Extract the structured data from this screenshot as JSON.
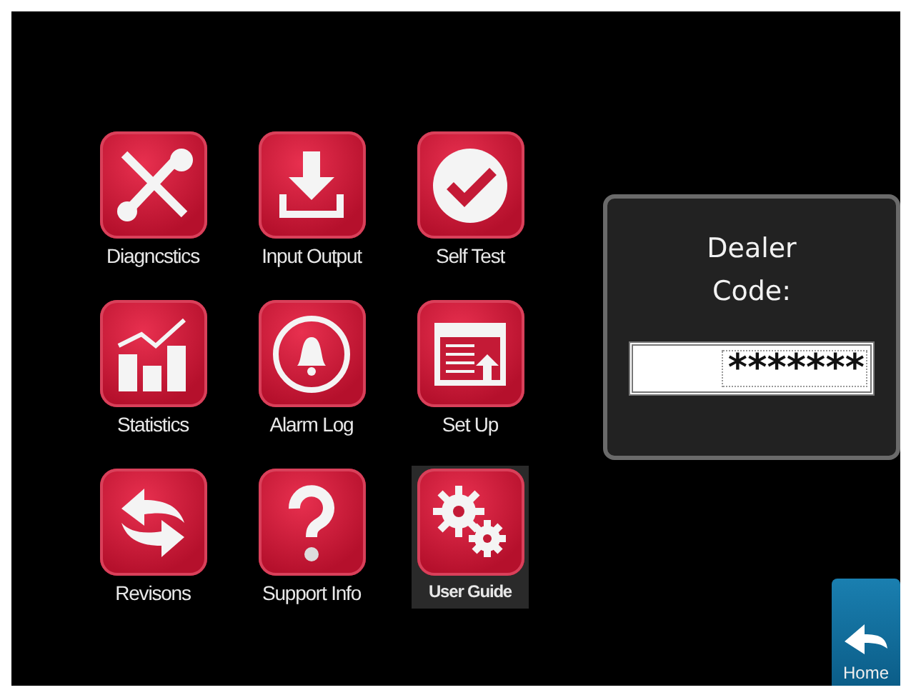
{
  "menu": [
    {
      "label": "Diagncstics",
      "selected": false
    },
    {
      "label": "Input Output",
      "selected": false
    },
    {
      "label": "Self Test",
      "selected": false
    },
    {
      "label": "Statistics",
      "selected": false
    },
    {
      "label": "Alarm Log",
      "selected": false
    },
    {
      "label": "Set Up",
      "selected": false
    },
    {
      "label": "Revisons",
      "selected": false
    },
    {
      "label": "Support Info",
      "selected": false
    },
    {
      "label": "User Guide",
      "selected": true
    }
  ],
  "dealer_code": {
    "title": "Dealer Code:",
    "value": "*******"
  },
  "home_button": {
    "label": "Home"
  }
}
